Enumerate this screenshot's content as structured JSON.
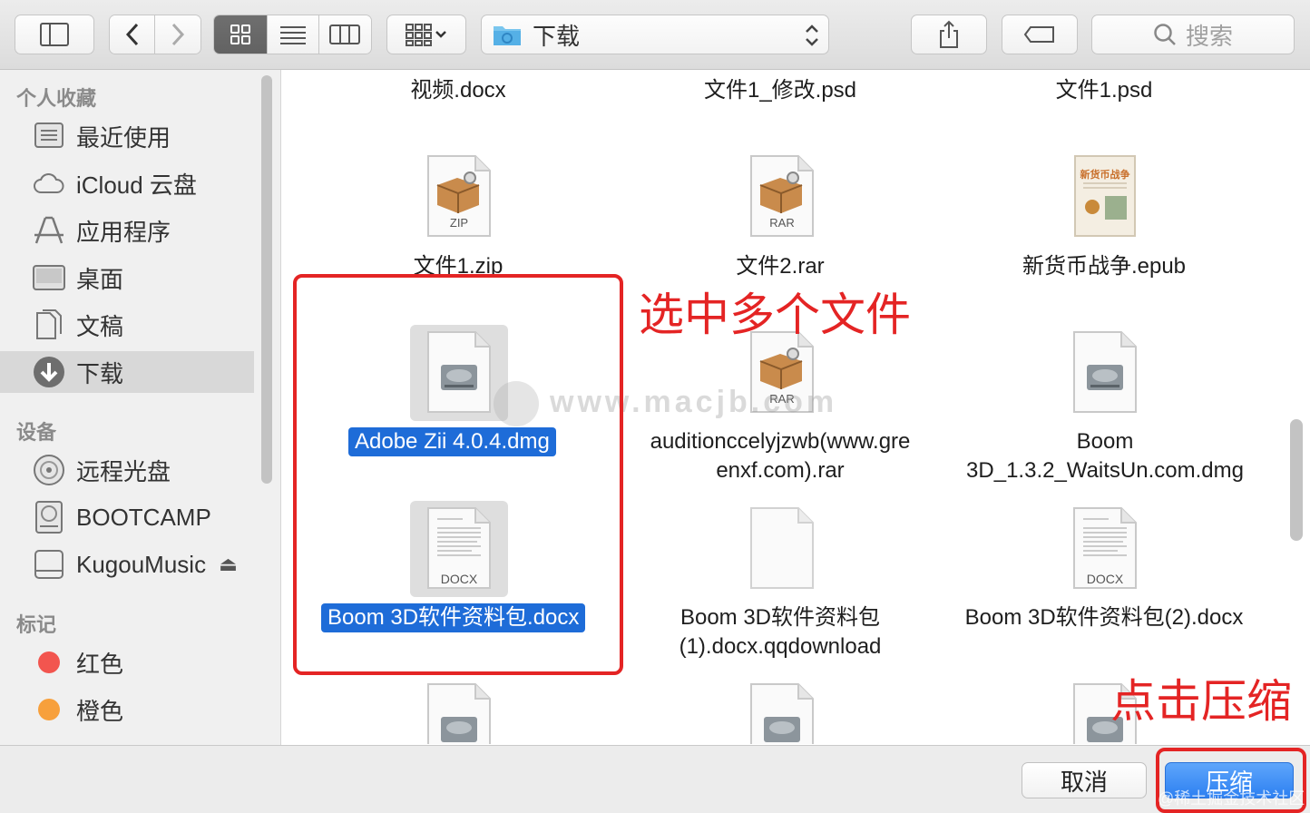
{
  "toolbar": {
    "path_folder": "下载",
    "search_placeholder": "搜索"
  },
  "sidebar": {
    "favorites_header": "个人收藏",
    "favorites": [
      {
        "label": "最近使用",
        "icon": "recents-icon"
      },
      {
        "label": "iCloud 云盘",
        "icon": "cloud-icon"
      },
      {
        "label": "应用程序",
        "icon": "applications-icon"
      },
      {
        "label": "桌面",
        "icon": "desktop-icon"
      },
      {
        "label": "文稿",
        "icon": "documents-icon"
      },
      {
        "label": "下载",
        "icon": "downloads-icon",
        "selected": true
      }
    ],
    "devices_header": "设备",
    "devices": [
      {
        "label": "远程光盘",
        "icon": "disc-icon"
      },
      {
        "label": "BOOTCAMP",
        "icon": "hard-disk-icon"
      },
      {
        "label": "KugouMusic",
        "icon": "drive-icon",
        "eject": "⏏"
      }
    ],
    "tags_header": "标记",
    "tags": [
      {
        "label": "红色",
        "color": "#f2554f"
      },
      {
        "label": "橙色",
        "color": "#f7a03c"
      }
    ]
  },
  "files": {
    "row0": [
      "视频.docx",
      "文件1_修改.psd",
      "文件1.psd"
    ],
    "row1": [
      {
        "name": "文件1.zip",
        "badge": "ZIP",
        "kind": "archive"
      },
      {
        "name": "文件2.rar",
        "badge": "RAR",
        "kind": "archive"
      },
      {
        "name": "新货币战争.epub",
        "cover_title": "新货币战争",
        "kind": "book"
      }
    ],
    "row2": [
      {
        "name": "Adobe Zii 4.0.4.dmg",
        "kind": "dmg",
        "selected": true
      },
      {
        "name_line1": "auditionccelyjzwb(www.gre",
        "name_line2": "enxf.com).rar",
        "badge": "RAR",
        "kind": "archive"
      },
      {
        "name_line1": "Boom",
        "name_line2": "3D_1.3.2_WaitsUn.com.dmg",
        "kind": "dmg"
      }
    ],
    "row3": [
      {
        "name": "Boom 3D软件资料包.docx",
        "badge": "DOCX",
        "kind": "docx",
        "selected": true
      },
      {
        "name_line1": "Boom 3D软件资料包",
        "name_line2": "(1).docx.qqdownload",
        "kind": "blank"
      },
      {
        "name": "Boom 3D软件资料包(2).docx",
        "badge": "DOCX",
        "kind": "docx"
      }
    ]
  },
  "annotations": {
    "select_multiple": "选中多个文件",
    "click_compress": "点击压缩",
    "watermark": "www.macjb.com",
    "credit": "@稀土掘金技术社区"
  },
  "buttons": {
    "cancel": "取消",
    "compress": "压缩"
  },
  "colors": {
    "selection": "#1e6cd8",
    "annotation_red": "#e42424",
    "primary_button": "#2d80f1"
  }
}
